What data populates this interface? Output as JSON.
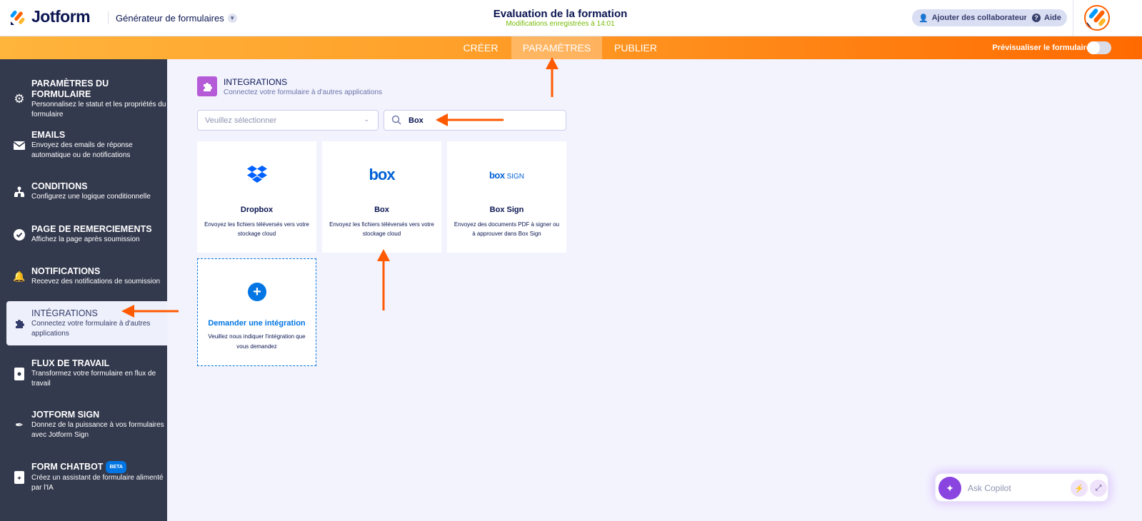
{
  "header": {
    "brand": "Jotform",
    "builder": "Générateur de formulaires",
    "title": "Evaluation de la formation",
    "saved": "Modifications enregistrées à 14:01",
    "collab": "Ajouter des collaborateurs",
    "help": "Aide"
  },
  "tabs": [
    {
      "label": "CRÉER"
    },
    {
      "label": "PARAMÈTRES"
    },
    {
      "label": "PUBLIER"
    }
  ],
  "preview": "Prévisualiser le formulaire",
  "sidebar": [
    {
      "title": "PARAMÈTRES DU FORMULAIRE",
      "desc": "Personnalisez le statut et les propriétés du formulaire"
    },
    {
      "title": "EMAILS",
      "desc": "Envoyez des emails de réponse automatique ou de notifications"
    },
    {
      "title": "CONDITIONS",
      "desc": "Configurez une logique conditionnelle"
    },
    {
      "title": "PAGE DE REMERCIEMENTS",
      "desc": "Affichez la page après soumission"
    },
    {
      "title": "NOTIFICATIONS",
      "desc": "Recevez des notifications de soumission"
    },
    {
      "title": "INTÉGRATIONS",
      "desc": "Connectez votre formulaire à d'autres applications"
    },
    {
      "title": "FLUX DE TRAVAIL",
      "desc": "Transformez votre formulaire en flux de travail"
    },
    {
      "title": "JOTFORM SIGN",
      "desc": "Donnez de la puissance à vos formulaires avec Jotform Sign"
    },
    {
      "title": "FORM CHATBOT",
      "desc": "Créez un assistant de formulaire alimenté par l'IA",
      "badge": "BETA"
    }
  ],
  "main": {
    "title": "INTEGRATIONS",
    "subtitle": "Connectez votre formulaire à d'autres applications",
    "select_placeholder": "Veuillez sélectionner",
    "search_value": "Box",
    "cards": [
      {
        "name": "Dropbox",
        "desc": "Envoyez les fichiers téléversés vers votre stockage cloud"
      },
      {
        "name": "Box",
        "desc": "Envoyez les fichiers téléversés vers votre stockage cloud",
        "logo": "box"
      },
      {
        "name": "Box Sign",
        "desc": "Envoyez des documents PDF à signer ou à approuver dans Box Sign",
        "logo": "box",
        "logo2": "SIGN"
      }
    ],
    "request": {
      "title": "Demander une intégration",
      "desc": "Veuillez nous indiquer l'intégration que vous demandez"
    }
  },
  "copilot": {
    "placeholder": "Ask Copilot"
  },
  "colors": {
    "orange": "#ff6100",
    "sidebar": "#343a4e",
    "blue": "#0075e3"
  }
}
